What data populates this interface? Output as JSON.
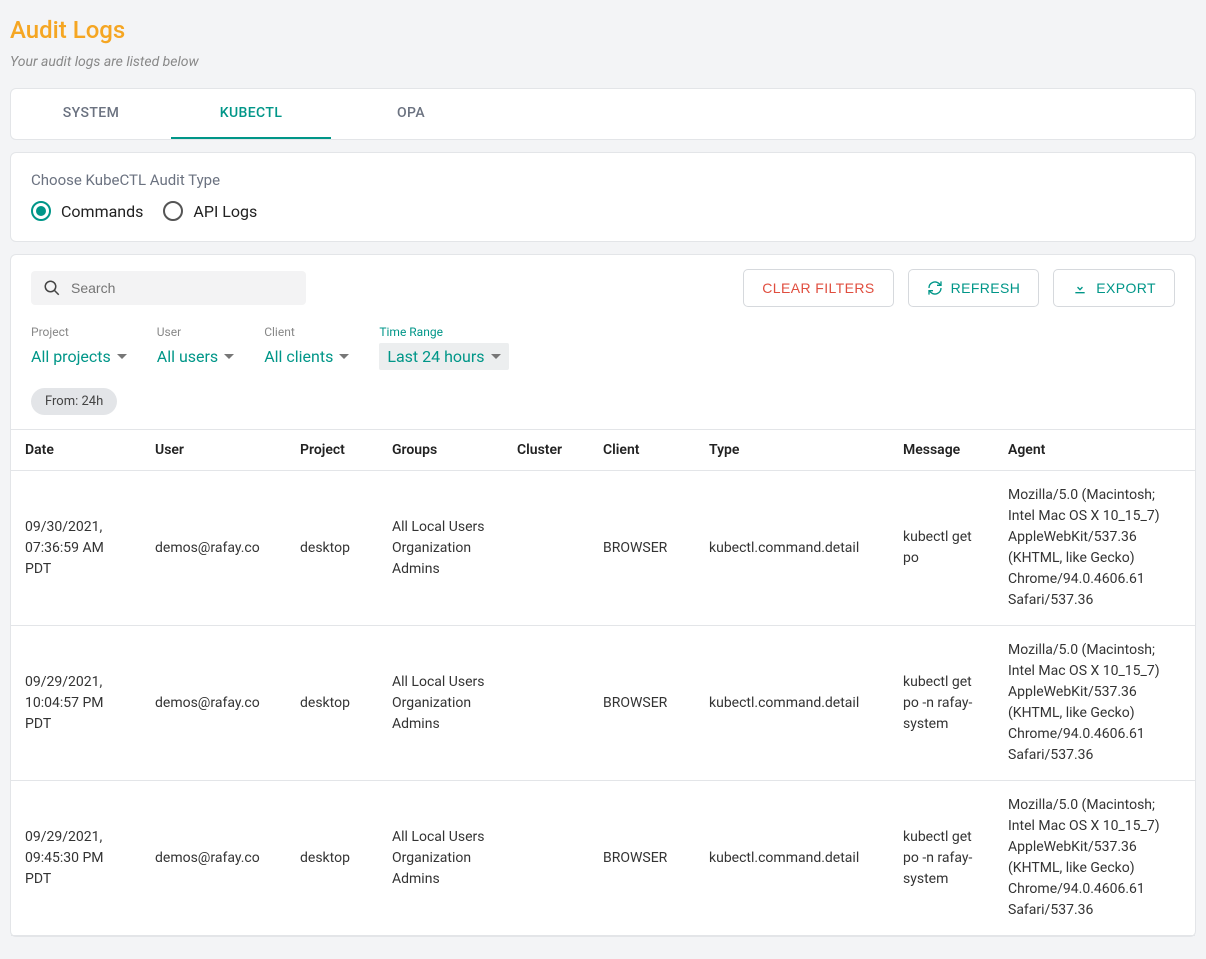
{
  "page": {
    "title": "Audit Logs",
    "subtitle": "Your audit logs are listed below"
  },
  "tabs": [
    {
      "label": "SYSTEM",
      "active": false
    },
    {
      "label": "KUBECTL",
      "active": true
    },
    {
      "label": "OPA",
      "active": false
    }
  ],
  "audit_type": {
    "label": "Choose KubeCTL Audit Type",
    "options": [
      {
        "label": "Commands",
        "checked": true
      },
      {
        "label": "API Logs",
        "checked": false
      }
    ]
  },
  "toolbar": {
    "search_placeholder": "Search",
    "clear_filters_label": "CLEAR FILTERS",
    "refresh_label": "REFRESH",
    "export_label": "EXPORT"
  },
  "filters": [
    {
      "label": "Project",
      "value": "All projects",
      "active": false
    },
    {
      "label": "User",
      "value": "All users",
      "active": false
    },
    {
      "label": "Client",
      "value": "All clients",
      "active": false
    },
    {
      "label": "Time Range",
      "value": "Last 24 hours",
      "active": true
    }
  ],
  "chip": {
    "label": "From: 24h"
  },
  "table": {
    "headers": [
      "Date",
      "User",
      "Project",
      "Groups",
      "Cluster",
      "Client",
      "Type",
      "Message",
      "Agent"
    ],
    "rows": [
      {
        "date": "09/30/2021, 07:36:59 AM PDT",
        "user": "demos@rafay.co",
        "project": "desktop",
        "groups": "All Local Users\nOrganization Admins",
        "cluster": "",
        "client": "BROWSER",
        "type": "kubectl.command.detail",
        "message": "kubectl get po",
        "agent": "Mozilla/5.0 (Macintosh; Intel Mac OS X 10_15_7) AppleWebKit/537.36 (KHTML, like Gecko) Chrome/94.0.4606.61 Safari/537.36"
      },
      {
        "date": "09/29/2021, 10:04:57 PM PDT",
        "user": "demos@rafay.co",
        "project": "desktop",
        "groups": "All Local Users\nOrganization Admins",
        "cluster": "",
        "client": "BROWSER",
        "type": "kubectl.command.detail",
        "message": "kubectl get po -n rafay-system",
        "agent": "Mozilla/5.0 (Macintosh; Intel Mac OS X 10_15_7) AppleWebKit/537.36 (KHTML, like Gecko) Chrome/94.0.4606.61 Safari/537.36"
      },
      {
        "date": "09/29/2021, 09:45:30 PM PDT",
        "user": "demos@rafay.co",
        "project": "desktop",
        "groups": "All Local Users\nOrganization Admins",
        "cluster": "",
        "client": "BROWSER",
        "type": "kubectl.command.detail",
        "message": "kubectl get po -n rafay-system",
        "agent": "Mozilla/5.0 (Macintosh; Intel Mac OS X 10_15_7) AppleWebKit/537.36 (KHTML, like Gecko) Chrome/94.0.4606.61 Safari/537.36"
      }
    ]
  }
}
